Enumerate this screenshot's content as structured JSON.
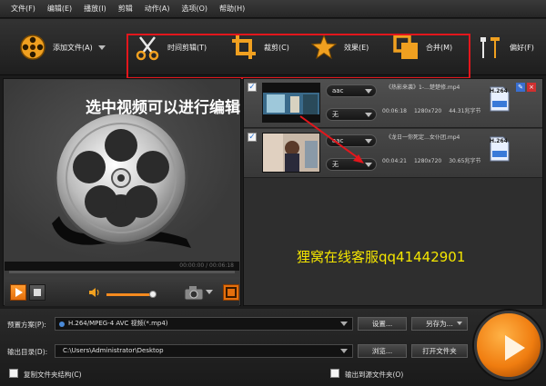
{
  "menu": [
    "文件(F)",
    "编辑(E)",
    "播放(I)",
    "剪辑",
    "动作(A)",
    "选项(O)",
    "帮助(H)"
  ],
  "toolbar": {
    "add_file": "添加文件(A)",
    "trim": "时间剪辑(T)",
    "crop": "裁剪(C)",
    "effect": "效果(E)",
    "merge": "合并(M)",
    "prefs": "偏好(F)"
  },
  "preview": {
    "timecode": "00:00:00 / 00:06:18",
    "progress_fraction": 0,
    "volume_fraction": 0.9
  },
  "files": [
    {
      "name": "《热影来袭》1-…楚楚修.mp4",
      "audio": "aac",
      "subtitle": "无",
      "duration": "00:06:18",
      "resolution": "1280x720",
      "size": "44.31兆字节",
      "codec": "H.264",
      "checked": true
    },
    {
      "name": "《龙日一你死定…女仆团.mp4",
      "audio": "aac",
      "subtitle": "无",
      "duration": "00:04:21",
      "resolution": "1280x720",
      "size": "30.65兆字节",
      "codec": "H.264",
      "checked": true
    }
  ],
  "annotation": "选中视频可以进行编辑",
  "watermark": "狸窝在线客服qq41442901",
  "bottom": {
    "preset_label": "预置方案(P):",
    "preset_value": "H.264/MPEG-4 AVC 视频(*.mp4)",
    "settings_btn": "设置...",
    "save_as_btn": "另存为...",
    "output_label": "输出目录(D):",
    "output_value": "C:\\Users\\Administrator\\Desktop",
    "browse_btn": "浏览...",
    "open_folder_btn": "打开文件夹",
    "copy_structure": "复制文件夹结构(C)",
    "output_to_source": "输出到源文件夹(O)"
  },
  "colors": {
    "accent": "#f07d10",
    "highlight_box": "#e3161c",
    "watermark": "#f5e600"
  }
}
